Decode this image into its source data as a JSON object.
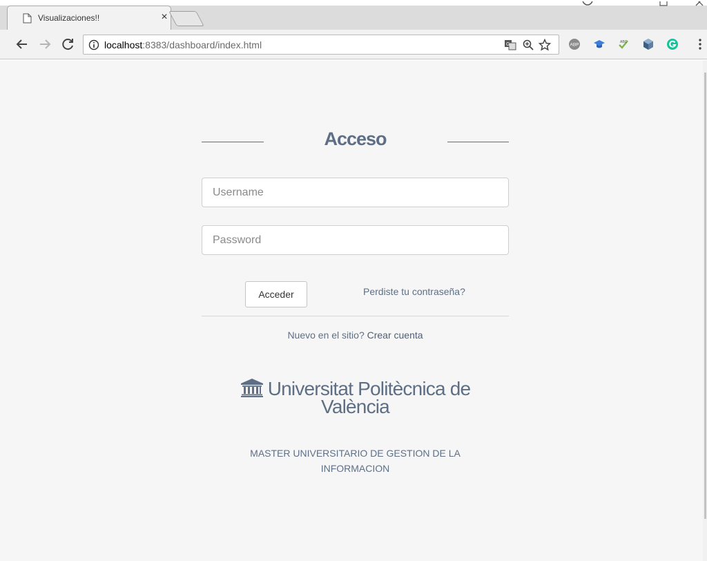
{
  "browser": {
    "tab_title": "Visualizaciones!!",
    "tab_close": "×",
    "url_host": "localhost",
    "url_rest": ":8383/dashboard/index.html"
  },
  "login": {
    "heading": "Acceso",
    "username_placeholder": "Username",
    "password_placeholder": "Password",
    "submit_label": "Acceder",
    "forgot_label": "Perdiste tu contraseña?",
    "signup_prompt": "Nuevo en el sitio?",
    "signup_link": "Crear cuenta"
  },
  "footer": {
    "university_line1": "Universitat Politècnica de",
    "university_line2": "València",
    "program_line1": "MASTER UNIVERSITARIO DE GESTION DE LA",
    "program_line2": "INFORMACION"
  },
  "colors": {
    "accent": "#5e6f85",
    "page_bg": "#f6f6f6"
  },
  "icons": [
    "page-icon",
    "back-arrow-icon",
    "forward-arrow-icon",
    "reload-icon",
    "info-icon",
    "translate-icon",
    "zoom-icon",
    "star-icon",
    "adblock-icon",
    "graduation-cap-icon",
    "spellcheck-icon",
    "cube-icon",
    "grammarly-icon",
    "menu-dots-icon",
    "university-icon"
  ]
}
